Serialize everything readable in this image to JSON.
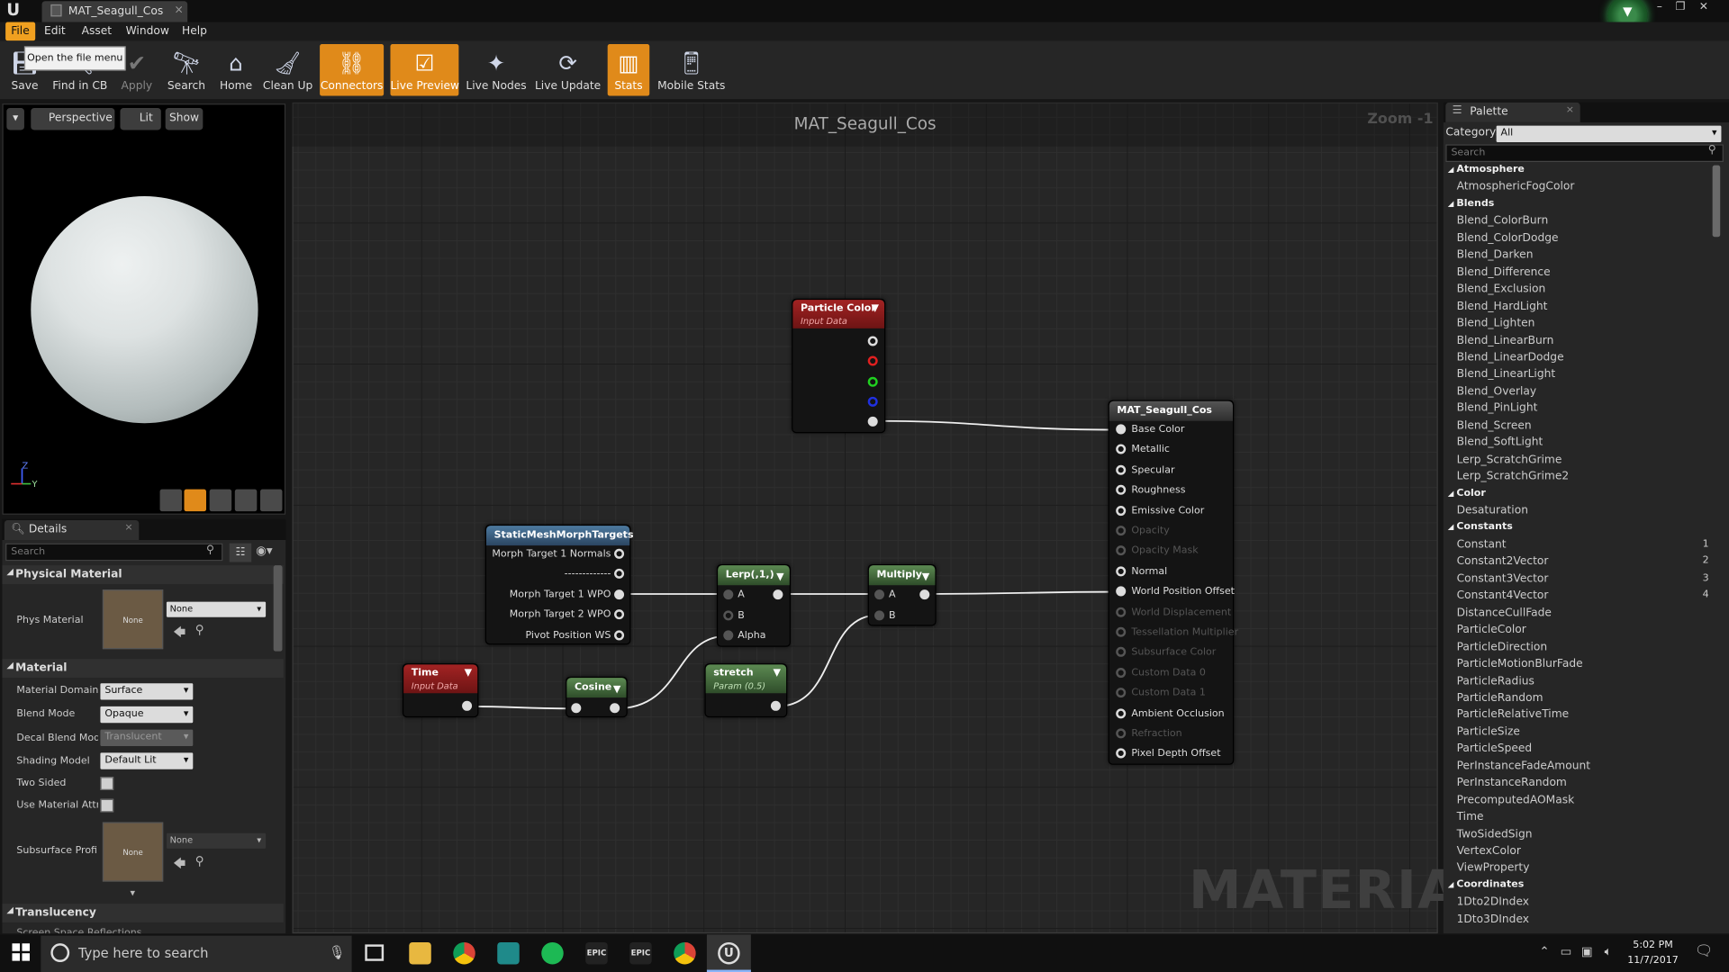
{
  "window": {
    "tab_title": "MAT_Seagull_Cos",
    "min": "–",
    "restore": "❐",
    "close": "✕"
  },
  "menu": [
    "File",
    "Edit",
    "Asset",
    "Window",
    "Help"
  ],
  "tooltip": "Open the file menu",
  "toolbar": [
    {
      "label": "Save",
      "icon": "save-icon",
      "active": false
    },
    {
      "label": "Find in CB",
      "icon": "find-in-cb-icon",
      "active": false
    },
    {
      "label": "Apply",
      "icon": "apply-icon",
      "active": false
    },
    {
      "label": "Search",
      "icon": "search-icon",
      "active": false
    },
    {
      "label": "Home",
      "icon": "home-icon",
      "active": false
    },
    {
      "label": "Clean Up",
      "icon": "clean-up-icon",
      "active": false
    },
    {
      "label": "Connectors",
      "icon": "connectors-icon",
      "active": true
    },
    {
      "label": "Live Preview",
      "icon": "live-preview-icon",
      "active": true
    },
    {
      "label": "Live Nodes",
      "icon": "live-nodes-icon",
      "active": false
    },
    {
      "label": "Live Update",
      "icon": "live-update-icon",
      "active": false
    },
    {
      "label": "Stats",
      "icon": "stats-icon",
      "active": true
    },
    {
      "label": "Mobile Stats",
      "icon": "mobile-stats-icon",
      "active": false
    }
  ],
  "viewport": {
    "perspective": "Perspective",
    "lit": "Lit",
    "show": "Show",
    "axis_z": "Z",
    "axis_y": "Y"
  },
  "details": {
    "tab": "Details",
    "search_placeholder": "Search",
    "physical_material": {
      "header": "Physical Material",
      "phys_label": "Phys Material",
      "thumb_text": "None",
      "value": "None"
    },
    "material": {
      "header": "Material",
      "domain_label": "Material Domain",
      "domain_value": "Surface",
      "blend_label": "Blend Mode",
      "blend_value": "Opaque",
      "decal_label": "Decal Blend Mode",
      "decal_value": "Translucent",
      "shading_label": "Shading Model",
      "shading_value": "Default Lit",
      "twosided_label": "Two Sided",
      "usemat_label": "Use Material Attributes",
      "subsurface_label": "Subsurface Profile",
      "subsurface_thumb": "None",
      "subsurface_value": "None"
    },
    "translucency": {
      "header": "Translucency",
      "cut_label": "Screen Space Reflections"
    }
  },
  "graph": {
    "title": "MAT_Seagull_Cos",
    "zoom": "Zoom -1",
    "watermark": "MATERIAL",
    "nodes": {
      "particle_color": {
        "title": "Particle Color",
        "sub": "Input Data"
      },
      "result": {
        "title": "MAT_Seagull_Cos",
        "pins": [
          {
            "label": "Base Color",
            "enabled": true,
            "connected": true
          },
          {
            "label": "Metallic",
            "enabled": true,
            "connected": false
          },
          {
            "label": "Specular",
            "enabled": true,
            "connected": false
          },
          {
            "label": "Roughness",
            "enabled": true,
            "connected": false
          },
          {
            "label": "Emissive Color",
            "enabled": true,
            "connected": false
          },
          {
            "label": "Opacity",
            "enabled": false,
            "connected": false
          },
          {
            "label": "Opacity Mask",
            "enabled": false,
            "connected": false
          },
          {
            "label": "Normal",
            "enabled": true,
            "connected": false
          },
          {
            "label": "World Position Offset",
            "enabled": true,
            "connected": true
          },
          {
            "label": "World Displacement",
            "enabled": false,
            "connected": false
          },
          {
            "label": "Tessellation Multiplier",
            "enabled": false,
            "connected": false
          },
          {
            "label": "Subsurface Color",
            "enabled": false,
            "connected": false
          },
          {
            "label": "Custom Data 0",
            "enabled": false,
            "connected": false
          },
          {
            "label": "Custom Data 1",
            "enabled": false,
            "connected": false
          },
          {
            "label": "Ambient Occlusion",
            "enabled": true,
            "connected": false
          },
          {
            "label": "Refraction",
            "enabled": false,
            "connected": false
          },
          {
            "label": "Pixel Depth Offset",
            "enabled": true,
            "connected": false
          }
        ]
      },
      "morph": {
        "title": "StaticMeshMorphTargets",
        "pins": [
          "Morph Target 1 Normals",
          "-------------",
          "Morph Target 1 WPO",
          "Morph Target 2 WPO",
          "Pivot Position WS"
        ]
      },
      "lerp": {
        "title": "Lerp(,1,)",
        "pins": [
          "A",
          "B",
          "Alpha"
        ]
      },
      "multiply": {
        "title": "Multiply",
        "pins": [
          "A",
          "B"
        ]
      },
      "time": {
        "title": "Time",
        "sub": "Input Data"
      },
      "cosine": {
        "title": "Cosine"
      },
      "stretch": {
        "title": "stretch",
        "sub": "Param (0.5)"
      }
    }
  },
  "palette": {
    "tab": "Palette",
    "category_label": "Category:",
    "category_value": "All",
    "search_placeholder": "Search",
    "rows": [
      {
        "cat": "Atmosphere"
      },
      {
        "item": "AtmosphericFogColor"
      },
      {
        "cat": "Blends"
      },
      {
        "item": "Blend_ColorBurn"
      },
      {
        "item": "Blend_ColorDodge"
      },
      {
        "item": "Blend_Darken"
      },
      {
        "item": "Blend_Difference"
      },
      {
        "item": "Blend_Exclusion"
      },
      {
        "item": "Blend_HardLight"
      },
      {
        "item": "Blend_Lighten"
      },
      {
        "item": "Blend_LinearBurn"
      },
      {
        "item": "Blend_LinearDodge"
      },
      {
        "item": "Blend_LinearLight"
      },
      {
        "item": "Blend_Overlay"
      },
      {
        "item": "Blend_PinLight"
      },
      {
        "item": "Blend_Screen"
      },
      {
        "item": "Blend_SoftLight"
      },
      {
        "item": "Lerp_ScratchGrime"
      },
      {
        "item": "Lerp_ScratchGrime2"
      },
      {
        "cat": "Color"
      },
      {
        "item": "Desaturation"
      },
      {
        "cat": "Constants"
      },
      {
        "item": "Constant",
        "hot": "1"
      },
      {
        "item": "Constant2Vector",
        "hot": "2"
      },
      {
        "item": "Constant3Vector",
        "hot": "3"
      },
      {
        "item": "Constant4Vector",
        "hot": "4"
      },
      {
        "item": "DistanceCullFade"
      },
      {
        "item": "ParticleColor"
      },
      {
        "item": "ParticleDirection"
      },
      {
        "item": "ParticleMotionBlurFade"
      },
      {
        "item": "ParticleRadius"
      },
      {
        "item": "ParticleRandom"
      },
      {
        "item": "ParticleRelativeTime"
      },
      {
        "item": "ParticleSize"
      },
      {
        "item": "ParticleSpeed"
      },
      {
        "item": "PerInstanceFadeAmount"
      },
      {
        "item": "PerInstanceRandom"
      },
      {
        "item": "PrecomputedAOMask"
      },
      {
        "item": "Time"
      },
      {
        "item": "TwoSidedSign"
      },
      {
        "item": "VertexColor"
      },
      {
        "item": "ViewProperty"
      },
      {
        "cat": "Coordinates"
      },
      {
        "item": "1Dto2DIndex"
      },
      {
        "item": "1Dto3DIndex"
      }
    ]
  },
  "taskbar": {
    "search_placeholder": "Type here to search",
    "time": "5:02 PM",
    "date": "11/7/2017",
    "apps": [
      "file-explorer-icon",
      "chrome-icon",
      "app-icon",
      "spotify-icon",
      "epic-games-icon",
      "epic-games-icon",
      "chrome-icon",
      "unreal-icon"
    ],
    "epic_label": "EPIC"
  },
  "colors": {
    "accent": "#e08a1a",
    "input_node": "#a32323",
    "param_node": "#5c8a52",
    "function_node": "#4d7aa0"
  }
}
